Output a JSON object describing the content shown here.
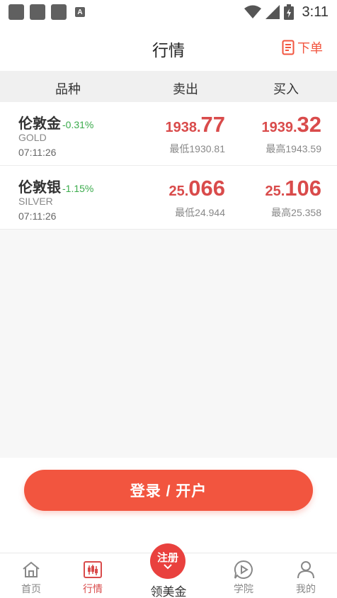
{
  "status_bar": {
    "time": "3:11"
  },
  "nav": {
    "title": "行情",
    "order_label": "下单"
  },
  "table_header": {
    "variety": "品种",
    "sell": "卖出",
    "buy": "买入"
  },
  "quotes": [
    {
      "name": "伦敦金",
      "change": "-0.31%",
      "code": "GOLD",
      "time": "07:11:26",
      "sell_int": "1938.",
      "sell_dec": "77",
      "sell_sub": "最低1930.81",
      "buy_int": "1939.",
      "buy_dec": "32",
      "buy_sub": "最高1943.59"
    },
    {
      "name": "伦敦银",
      "change": "-1.15%",
      "code": "SILVER",
      "time": "07:11:26",
      "sell_int": "25.",
      "sell_dec": "066",
      "sell_sub": "最低24.944",
      "buy_int": "25.",
      "buy_dec": "106",
      "buy_sub": "最高25.358"
    }
  ],
  "login": {
    "label": "登录 / 开户"
  },
  "tabs": {
    "home": "首页",
    "quote": "行情",
    "center_badge": "注册",
    "center_label": "领美金",
    "academy": "学院",
    "mine": "我的"
  },
  "colors": {
    "accent": "#f2553f",
    "price_red": "#d94b4b",
    "change_green": "#3bab4c"
  }
}
